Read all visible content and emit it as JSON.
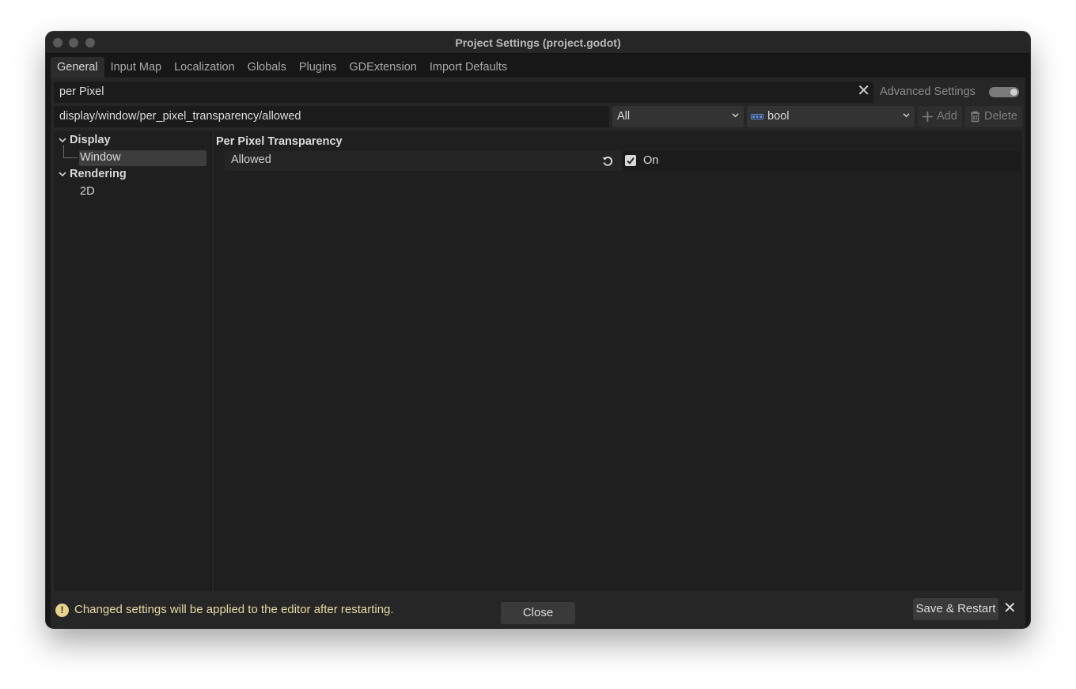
{
  "window": {
    "title": "Project Settings (project.godot)"
  },
  "tabs": [
    {
      "label": "General",
      "active": true
    },
    {
      "label": "Input Map"
    },
    {
      "label": "Localization"
    },
    {
      "label": "Globals"
    },
    {
      "label": "Plugins"
    },
    {
      "label": "GDExtension"
    },
    {
      "label": "Import Defaults"
    }
  ],
  "search": {
    "value": "per Pixel"
  },
  "advanced": {
    "label": "Advanced Settings",
    "enabled": true
  },
  "property_path": {
    "value": "display/window/per_pixel_transparency/allowed"
  },
  "feature_dropdown": {
    "value": "All"
  },
  "type_dropdown": {
    "value": "bool",
    "icon": "bool-icon",
    "icon_color": "#5a8ee0"
  },
  "buttons": {
    "add": "Add",
    "delete": "Delete"
  },
  "tree": {
    "items": [
      {
        "label": "Display"
      },
      {
        "label": "Window"
      },
      {
        "label": "Rendering"
      },
      {
        "label": "2D"
      }
    ]
  },
  "inspector": {
    "section": "Per Pixel Transparency",
    "property": {
      "name": "Allowed",
      "value_label": "On",
      "checked": true
    }
  },
  "notice": {
    "text": "Changed settings will be applied to the editor after restarting.",
    "save_restart": "Save & Restart",
    "color": "#e6d9a4"
  },
  "close_button": "Close"
}
